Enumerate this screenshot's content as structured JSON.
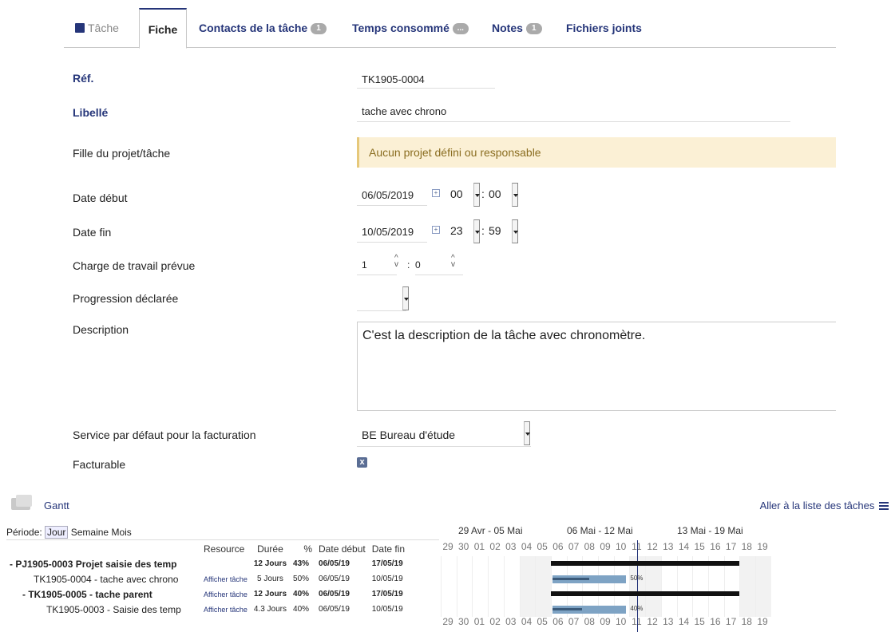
{
  "tabs": [
    {
      "label": "Tâche",
      "badge": "",
      "state": "disabled"
    },
    {
      "label": "Fiche",
      "badge": "",
      "state": "active"
    },
    {
      "label": "Contacts de la tâche",
      "badge": "1",
      "state": "normal"
    },
    {
      "label": "Temps consommé",
      "badge": "...",
      "state": "normal"
    },
    {
      "label": "Notes",
      "badge": "1",
      "state": "normal"
    },
    {
      "label": "Fichiers joints",
      "badge": "",
      "state": "normal"
    }
  ],
  "form": {
    "ref_label": "Réf.",
    "ref_value": "TK1905-0004",
    "libelle_label": "Libellé",
    "libelle_value": "tache avec chrono",
    "parent_label": "Fille du projet/tâche",
    "parent_warning": "Aucun projet défini ou responsable",
    "start_label": "Date début",
    "start_date": "06/05/2019",
    "start_hour": "00",
    "start_min": "00",
    "end_label": "Date fin",
    "end_date": "10/05/2019",
    "end_hour": "23",
    "end_min": "59",
    "workload_label": "Charge de travail prévue",
    "workload_hours": "1",
    "workload_minutes": "0",
    "progress_label": "Progression déclarée",
    "progress_value": "",
    "description_label": "Description",
    "description_value": "C'est la description de la tâche avec chronomètre.",
    "service_label": "Service par défaut pour la facturation",
    "service_value": "BE Bureau d'étude",
    "billable_label": "Facturable",
    "billable_mark": "x"
  },
  "gantt": {
    "title": "Gantt",
    "list_link": "Aller à la liste des tâches",
    "period_label": "Période:",
    "period_options": [
      "Jour",
      "Semaine",
      "Mois"
    ],
    "period_selected": "Jour",
    "columns": [
      "Resource",
      "Durée",
      "%",
      "Date début",
      "Date fin"
    ],
    "weeks": [
      "29 Avr - 05 Mai",
      "06 Mai - 12 Mai",
      "13 Mai - 19 Mai"
    ],
    "days": [
      "29",
      "30",
      "01",
      "02",
      "03",
      "04",
      "05",
      "06",
      "07",
      "08",
      "09",
      "10",
      "11",
      "12",
      "13",
      "14",
      "15",
      "16",
      "17",
      "18",
      "19"
    ],
    "rows": [
      {
        "name": "- PJ1905-0003 Projet saisie des temp",
        "resource": "",
        "duration": "12 Jours",
        "percent": "43%",
        "start": "06/05/19",
        "end": "17/05/19",
        "bold": true,
        "kind": "group"
      },
      {
        "name": "TK1905-0004 - tache avec chrono",
        "resource": "Afficher tâche",
        "duration": "5 Jours",
        "percent": "50%",
        "start": "06/05/19",
        "end": "10/05/19",
        "bold": false,
        "kind": "task",
        "progress": 0.5,
        "bar_label": "50%"
      },
      {
        "name": "- TK1905-0005 - tache parent",
        "resource": "Afficher tâche",
        "duration": "12 Jours",
        "percent": "40%",
        "start": "06/05/19",
        "end": "17/05/19",
        "bold": true,
        "kind": "group"
      },
      {
        "name": "TK1905-0003 - Saisie des temp",
        "resource": "Afficher tâche",
        "duration": "4.3 Jours",
        "percent": "40%",
        "start": "06/05/19",
        "end": "10/05/19",
        "bold": false,
        "kind": "task",
        "progress": 0.4,
        "bar_label": "40%"
      }
    ],
    "today": "11"
  }
}
